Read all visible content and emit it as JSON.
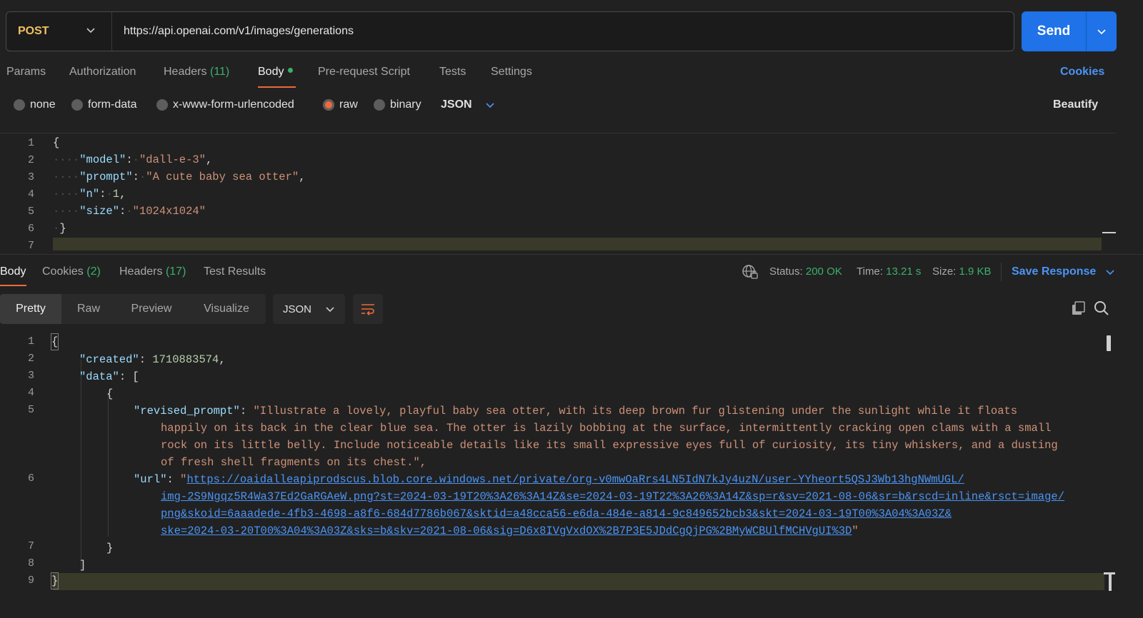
{
  "request": {
    "method": "POST",
    "url": "https://api.openai.com/v1/images/generations",
    "send_label": "Send"
  },
  "request_tabs": {
    "params": "Params",
    "authorization": "Authorization",
    "headers": "Headers",
    "headers_count": "(11)",
    "body": "Body",
    "pre_request": "Pre-request Script",
    "tests": "Tests",
    "settings": "Settings",
    "cookies": "Cookies"
  },
  "body_types": {
    "none": "none",
    "form_data": "form-data",
    "urlencoded": "x-www-form-urlencoded",
    "raw": "raw",
    "binary": "binary",
    "format": "JSON",
    "beautify": "Beautify",
    "selected": "raw"
  },
  "request_body": {
    "line_numbers": [
      "1",
      "2",
      "3",
      "4",
      "5",
      "6",
      "7"
    ],
    "open": "{",
    "close": "}",
    "model_key": "\"model\"",
    "model_val": "\"dall-e-3\"",
    "prompt_key": "\"prompt\"",
    "prompt_val": "\"A cute baby sea otter\"",
    "n_key": "\"n\"",
    "n_val": "1",
    "size_key": "\"size\"",
    "size_val": "\"1024x1024\""
  },
  "response_tabs": {
    "body": "Body",
    "cookies": "Cookies",
    "cookies_count": "(2)",
    "headers": "Headers",
    "headers_count": "(17)",
    "test_results": "Test Results"
  },
  "response_status": {
    "status_label": "Status:",
    "status_value": "200 OK",
    "time_label": "Time:",
    "time_value": "13.21 s",
    "size_label": "Size:",
    "size_value": "1.9 KB",
    "save_response": "Save Response"
  },
  "response_view": {
    "pretty": "Pretty",
    "raw": "Raw",
    "preview": "Preview",
    "visualize": "Visualize",
    "format": "JSON"
  },
  "response_body": {
    "line_numbers": [
      "1",
      "2",
      "3",
      "4",
      "5",
      "6",
      "7",
      "8",
      "9"
    ],
    "created_key": "\"created\"",
    "created_val": "1710883574",
    "data_key": "\"data\"",
    "revised_prompt_key": "\"revised_prompt\"",
    "revised_prompt_lines": [
      "\"Illustrate a lovely, playful baby sea otter, with its deep brown fur glistening under the sunlight while it floats",
      "happily on its back in the clear blue sea. The otter is lazily bobbing at the surface, intermittently cracking open clams with a small",
      "rock on its little belly. Include noticeable details like its small expressive eyes full of curiosity, its tiny whiskers, and a dusting",
      "of fresh shell fragments on its chest.\","
    ],
    "url_key": "\"url\"",
    "url_lines": [
      "https://oaidalleapiprodscus.blob.core.windows.net/private/org-v0mwOaRrs4LN5IdN7kJy4uzN/user-YYheort5QSJ3Wb13hgNWmUGL/",
      "img-2S9Ngqz5R4Wa37Ed2GaRGAeW.png?st=2024-03-19T20%3A26%3A14Z&se=2024-03-19T22%3A26%3A14Z&sp=r&sv=2021-08-06&sr=b&rscd=inline&rsct=image/",
      "png&skoid=6aaadede-4fb3-4698-a8f6-684d7786b067&sktid=a48cca56-e6da-484e-a814-9c849652bcb3&skt=2024-03-19T00%3A04%3A03Z&",
      "ske=2024-03-20T00%3A04%3A03Z&sks=b&skv=2021-08-06&sig=D6x8IVgVxdOX%2B7P3E5JDdCgQjPG%2BMyWCBUlfMCHVgUI%3D"
    ]
  },
  "colors": {
    "accent_orange": "#ef6a3a",
    "send_blue": "#1f72e8",
    "link_blue": "#4b94f5",
    "status_green": "#3bb06b",
    "method_yellow": "#f0c060"
  }
}
